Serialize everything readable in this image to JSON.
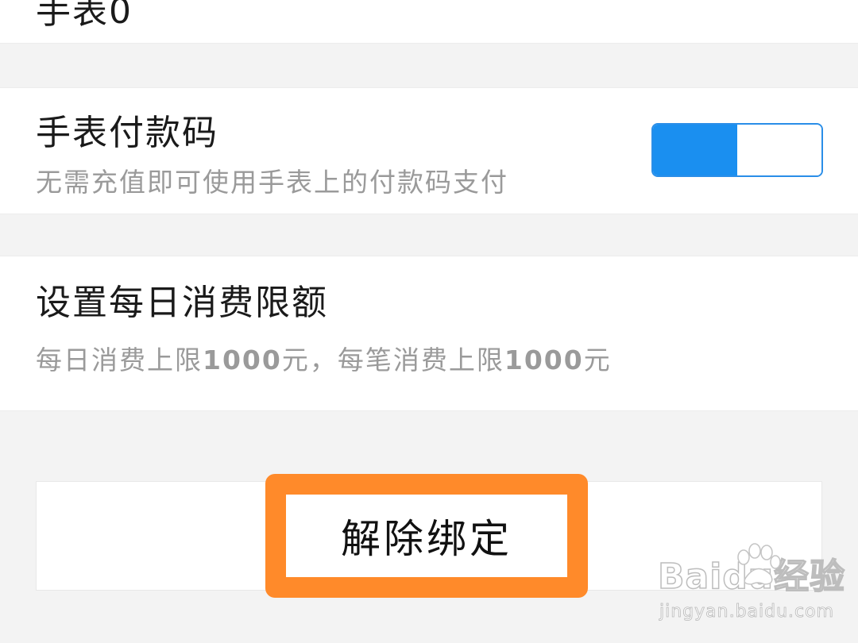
{
  "top_partial": {
    "title_cut": "手表0"
  },
  "watch_pay": {
    "title": "手表付款码",
    "subtitle": "无需充值即可使用手表上的付款码支付",
    "toggle_on": true,
    "toggle_fill_fraction": 0.5
  },
  "daily_limit": {
    "title": "设置每日消费限额",
    "subtitle_prefix": "每日消费上限",
    "daily_amount": "1000",
    "subtitle_mid": "元，每笔消费上限",
    "per_amount": "1000",
    "subtitle_suffix": "元"
  },
  "unbind": {
    "label": "解除绑定"
  },
  "watermark": {
    "logo_text": "Bai",
    "logo_text_2": "du",
    "logo_cn": "经验",
    "url": "jingyan.baidu.com"
  },
  "colors": {
    "accent": "#1a8ff0",
    "highlight": "#ff8a2a",
    "background": "#f3f3f3"
  }
}
